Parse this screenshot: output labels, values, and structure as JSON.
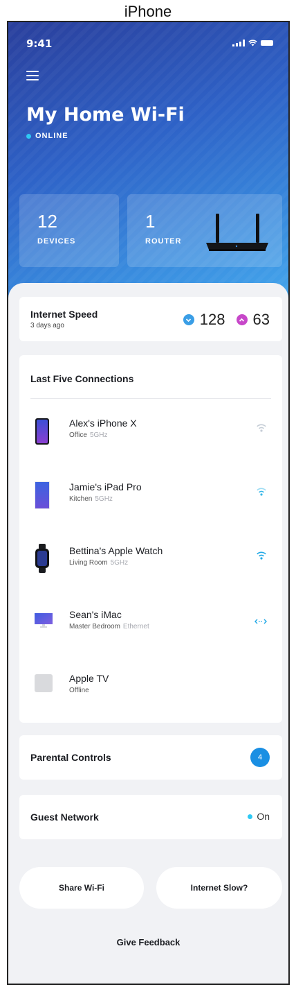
{
  "device_label": "iPhone",
  "status_bar": {
    "time": "9:41"
  },
  "header": {
    "title": "My Home Wi-Fi",
    "status": "ONLINE",
    "status_color": "#2ec9f4"
  },
  "stats": {
    "devices": {
      "count": "12",
      "label": "DEVICES"
    },
    "router": {
      "count": "1",
      "label": "ROUTER"
    }
  },
  "internet_speed": {
    "title": "Internet Speed",
    "subtitle": "3 days ago",
    "download": "128",
    "upload": "63",
    "download_color": "#3a9ee6",
    "upload_color": "#c747c9"
  },
  "connections": {
    "title": "Last Five Connections",
    "items": [
      {
        "name": "Alex's iPhone X",
        "location": "Office",
        "band": "5GHz",
        "icon": "iphone-icon",
        "indicator": "wifi-weak-icon"
      },
      {
        "name": "Jamie's iPad Pro",
        "location": "Kitchen",
        "band": "5GHz",
        "icon": "ipad-icon",
        "indicator": "wifi-medium-icon"
      },
      {
        "name": "Bettina's Apple Watch",
        "location": "Living Room",
        "band": "5GHz",
        "icon": "apple-watch-icon",
        "indicator": "wifi-strong-icon"
      },
      {
        "name": "Sean's iMac",
        "location": "Master Bedroom",
        "band": "Ethernet",
        "icon": "imac-icon",
        "indicator": "ethernet-icon"
      },
      {
        "name": "Apple TV",
        "location": "Offline",
        "band": "",
        "icon": "apple-tv-icon",
        "indicator": ""
      }
    ]
  },
  "parental_controls": {
    "label": "Parental Controls",
    "count": "4"
  },
  "guest_network": {
    "label": "Guest Network",
    "status": "On",
    "status_color": "#2ec9f4"
  },
  "actions": {
    "share": "Share Wi-Fi",
    "slow": "Internet Slow?"
  },
  "feedback": "Give Feedback",
  "colors": {
    "accent": "#1a8fe3",
    "hero_start": "#2a3f9c",
    "hero_end": "#49aef0"
  }
}
